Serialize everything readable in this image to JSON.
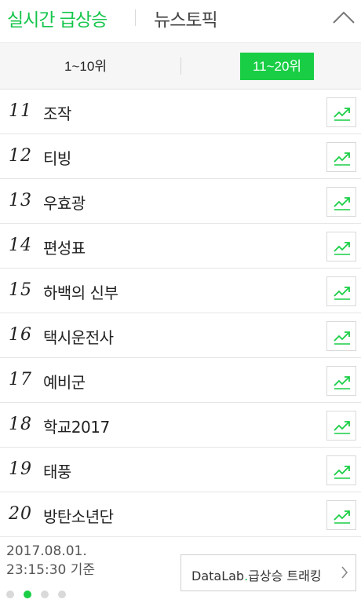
{
  "header": {
    "tab_realtime": "실시간 급상승",
    "tab_news": "뉴스토픽"
  },
  "range_tabs": {
    "left": "1~10위",
    "right": "11~20위",
    "active": "right"
  },
  "keywords": [
    {
      "rank": "11",
      "keyword": "조작"
    },
    {
      "rank": "12",
      "keyword": "티빙"
    },
    {
      "rank": "13",
      "keyword": "우효광"
    },
    {
      "rank": "14",
      "keyword": "편성표"
    },
    {
      "rank": "15",
      "keyword": "하백의 신부"
    },
    {
      "rank": "16",
      "keyword": "택시운전사"
    },
    {
      "rank": "17",
      "keyword": "예비군"
    },
    {
      "rank": "18",
      "keyword": "학교2017"
    },
    {
      "rank": "19",
      "keyword": "태풍"
    },
    {
      "rank": "20",
      "keyword": "방탄소년단"
    }
  ],
  "footer": {
    "date": "2017.08.01.",
    "time": "23:15:30 기준",
    "datalab_prefix": "DataLab",
    "datalab_dot": ".",
    "datalab_suffix": "급상승 트래킹"
  },
  "pager": {
    "count": 4,
    "active_index": 1
  },
  "colors": {
    "accent": "#19ce45",
    "accent_text": "#15c54b"
  },
  "icons": {
    "collapse": "chevron-up-icon",
    "trend": "trend-chart-icon",
    "datalab_arrow": "chevron-right-icon"
  }
}
